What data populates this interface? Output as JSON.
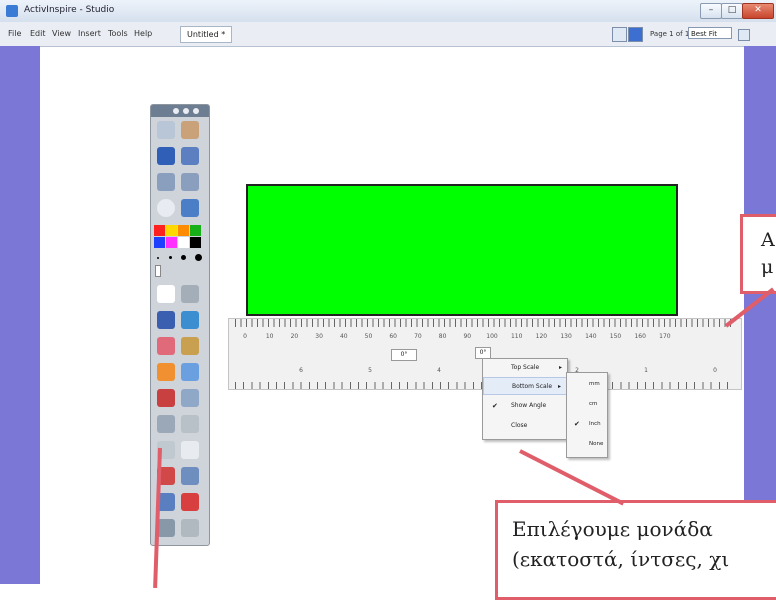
{
  "window": {
    "title": "ActivInspire - Studio",
    "minimize_label": "–",
    "maximize_label": "□",
    "close_label": "✕"
  },
  "menu": {
    "items": [
      "File",
      "Edit",
      "View",
      "Insert",
      "Tools",
      "Help"
    ],
    "doc_tab": "Untitled *",
    "page_label": "Page 1 of 1",
    "zoom": "Best Fit"
  },
  "ruler": {
    "cm_labels": [
      "0",
      "10",
      "20",
      "30",
      "40",
      "50",
      "60",
      "70",
      "80",
      "90",
      "100",
      "110",
      "120",
      "130",
      "140",
      "150",
      "160",
      "170"
    ],
    "inch_labels": [
      "0",
      "1",
      "2",
      "3",
      "4",
      "5",
      "6"
    ],
    "angle_left": "0°",
    "angle_right": "0°"
  },
  "context_menu": {
    "items": [
      {
        "label": "Top Scale",
        "checked": false,
        "arrow": "▸"
      },
      {
        "label": "Bottom Scale",
        "checked": false,
        "arrow": "▸"
      },
      {
        "label": "Show Angle",
        "checked": true,
        "arrow": ""
      },
      {
        "label": "Close",
        "checked": false,
        "arrow": ""
      }
    ]
  },
  "submenu": {
    "items": [
      {
        "label": "mm",
        "checked": false
      },
      {
        "label": "cm",
        "checked": false
      },
      {
        "label": "Inch",
        "checked": true
      },
      {
        "label": "None",
        "checked": false
      }
    ]
  },
  "annotations": {
    "top_right_line1": "Α",
    "top_right_line2": "μ",
    "bottom_line1": "Επιλέγουμε μονάδα",
    "bottom_line2": "(εκατοστά, ίντσες, χι"
  },
  "colors": {
    "canvas_object": "#00ff00",
    "side_strip": "#7a77d6",
    "callout_border": "#e05d6a"
  }
}
